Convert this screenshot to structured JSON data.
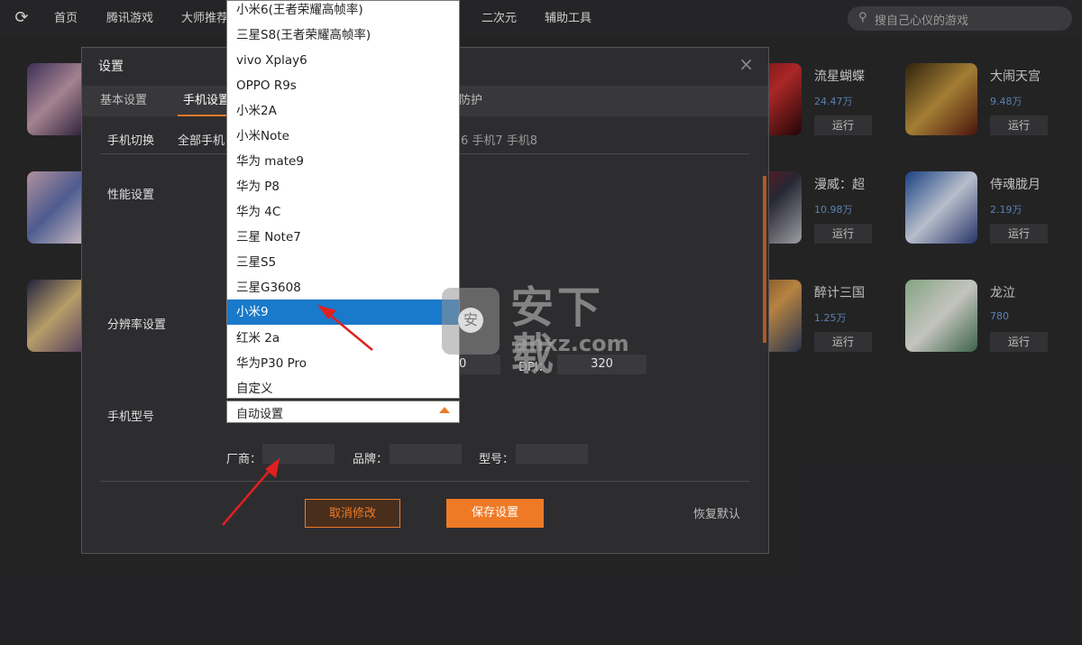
{
  "topnav": {
    "items": [
      "首页",
      "腾讯游戏",
      "大师推荐",
      "二次元",
      "辅助工具"
    ],
    "search_placeholder": "搜自己心仪的游戏"
  },
  "games": [
    {
      "name": "流星蝴蝶",
      "count": "24.47万",
      "run": "运行"
    },
    {
      "name": "大闹天宫",
      "count": "9.48万",
      "run": "运行"
    },
    {
      "name": "漫威：超",
      "count": "10.98万",
      "run": "运行"
    },
    {
      "name": "侍魂胧月",
      "count": "2.19万",
      "run": "运行"
    },
    {
      "name": "醉计三国",
      "count": "1.25万",
      "run": "运行"
    },
    {
      "name": "龙泣",
      "count": "780",
      "run": "运行"
    }
  ],
  "dialog": {
    "title": "设置",
    "close": "×",
    "tabs": [
      "基本设置",
      "手机设置",
      "防护"
    ],
    "phone_switch": {
      "label": "手机切换",
      "all": "全部手机",
      "rest": "6  手机7  手机8"
    },
    "performance_label": "性能设置",
    "resolution_label": "分辨率设置",
    "resolution_value": "0",
    "dpi_label": "DPI：",
    "dpi_value": "320",
    "model_label": "手机型号",
    "model_selected": "自动设置",
    "vendor_label": "厂商：",
    "brand_label": "品牌：",
    "type_label": "型号：",
    "cancel": "取消修改",
    "save": "保存设置",
    "reset": "恢复默认"
  },
  "dropdown": {
    "options": [
      "小米6(王者荣耀高帧率)",
      "三星S8(王者荣耀高帧率)",
      "vivo Xplay6",
      "OPPO R9s",
      "小米2A",
      "小米Note",
      "华为 mate9",
      "华为 P8",
      "华为 4C",
      "三星 Note7",
      "三星S5",
      "三星G3608",
      "小米9",
      "红米 2a",
      "华为P30 Pro",
      "自定义"
    ],
    "selected_index": 12
  },
  "watermark": {
    "main": "安下载",
    "sub": "anxz.com",
    "shield": "安"
  },
  "colors": {
    "accent": "#ee7a26",
    "selected": "#1979ca",
    "arrow": "#e02020"
  }
}
